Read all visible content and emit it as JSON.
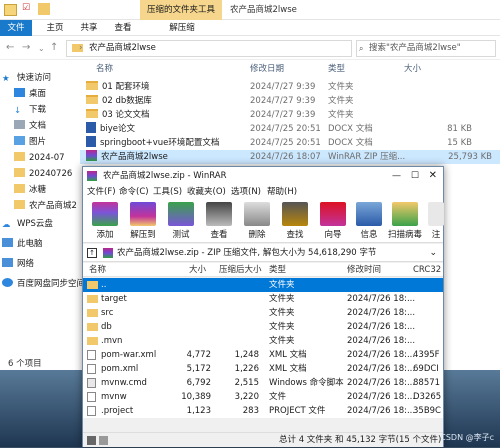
{
  "explorer": {
    "context_tab": "压缩的文件夹工具",
    "window_title": "农产品商城2lwse",
    "ribbon_tabs": [
      "文件",
      "主页",
      "共享",
      "查看",
      "解压缩"
    ],
    "address": "农产品商城2lwse",
    "search_placeholder": "搜索\"农产品商城2lwse\"",
    "headers": {
      "name": "名称",
      "date": "修改日期",
      "type": "类型",
      "size": "大小"
    },
    "files": [
      {
        "name": "01 配套环境",
        "date": "2024/7/27 9:39",
        "type": "文件夹",
        "size": "",
        "kind": "folder"
      },
      {
        "name": "02 db数据库",
        "date": "2024/7/27 9:39",
        "type": "文件夹",
        "size": "",
        "kind": "folder"
      },
      {
        "name": "03 论文文档",
        "date": "2024/7/27 9:39",
        "type": "文件夹",
        "size": "",
        "kind": "folder"
      },
      {
        "name": "biye论文",
        "date": "2024/7/25 20:51",
        "type": "DOCX 文档",
        "size": "81 KB",
        "kind": "docx"
      },
      {
        "name": "springboot+vue环境配置文档",
        "date": "2024/7/25 20:51",
        "type": "DOCX 文档",
        "size": "15 KB",
        "kind": "docx"
      },
      {
        "name": "农产品商城2lwse",
        "date": "2024/7/26 18:07",
        "type": "WinRAR ZIP 压缩...",
        "size": "25,793 KB",
        "kind": "rar"
      }
    ],
    "sidebar": [
      "快速访问",
      "桌面",
      "下载",
      "文档",
      "图片",
      "2024-07",
      "20240726",
      "冰糖",
      "农产品商城2",
      "WPS云盘",
      "此电脑",
      "网络",
      "百度网盘同步空间"
    ],
    "status": "6 个项目"
  },
  "rar": {
    "title": "农产品商城2lwse.zip - WinRAR",
    "menu": [
      "文件(F)",
      "命令(C)",
      "工具(S)",
      "收藏夹(O)",
      "选项(N)",
      "帮助(H)"
    ],
    "tools": [
      "添加",
      "解压到",
      "测试",
      "查看",
      "删除",
      "查找",
      "向导",
      "信息",
      "扫描病毒",
      "注"
    ],
    "path": "农产品商城2lwse.zip - ZIP 压缩文件, 解包大小为 54,618,290 字节",
    "headers": {
      "name": "名称",
      "size": "大小",
      "packed": "压缩后大小",
      "type": "类型",
      "modified": "修改时间",
      "crc": "CRC32"
    },
    "rows": [
      {
        "name": "..",
        "size": "",
        "packed": "",
        "type": "文件夹",
        "modified": "",
        "crc": "",
        "kind": "folder"
      },
      {
        "name": "target",
        "size": "",
        "packed": "",
        "type": "文件夹",
        "modified": "2024/7/26 18:...",
        "crc": "",
        "kind": "folder"
      },
      {
        "name": "src",
        "size": "",
        "packed": "",
        "type": "文件夹",
        "modified": "2024/7/26 18:...",
        "crc": "",
        "kind": "folder"
      },
      {
        "name": "db",
        "size": "",
        "packed": "",
        "type": "文件夹",
        "modified": "2024/7/26 18:...",
        "crc": "",
        "kind": "folder"
      },
      {
        "name": ".mvn",
        "size": "",
        "packed": "",
        "type": "文件夹",
        "modified": "2024/7/26 18:...",
        "crc": "",
        "kind": "folder"
      },
      {
        "name": "pom-war.xml",
        "size": "4,772",
        "packed": "1,248",
        "type": "XML 文档",
        "modified": "2024/7/26 18:...",
        "crc": "4395F",
        "kind": "file"
      },
      {
        "name": "pom.xml",
        "size": "5,172",
        "packed": "1,226",
        "type": "XML 文档",
        "modified": "2024/7/26 18:...",
        "crc": "69DCI",
        "kind": "file"
      },
      {
        "name": "mvnw.cmd",
        "size": "6,792",
        "packed": "2,515",
        "type": "Windows 命令脚本",
        "modified": "2024/7/26 18:...",
        "crc": "88571",
        "kind": "file"
      },
      {
        "name": "mvnw",
        "size": "10,389",
        "packed": "3,220",
        "type": "文件",
        "modified": "2024/7/26 18:...",
        "crc": "D3265",
        "kind": "file"
      },
      {
        "name": ".project",
        "size": "1,123",
        "packed": "283",
        "type": "PROJECT 文件",
        "modified": "2024/7/26 18:...",
        "crc": "35B9C",
        "kind": "file"
      }
    ],
    "status": "总计 4 文件夹 和 45,132 字节(15 个文件)",
    "watermark": "CSDN @李子c"
  },
  "colors": {
    "accent": "#1979ca",
    "selection": "#0078d7"
  }
}
